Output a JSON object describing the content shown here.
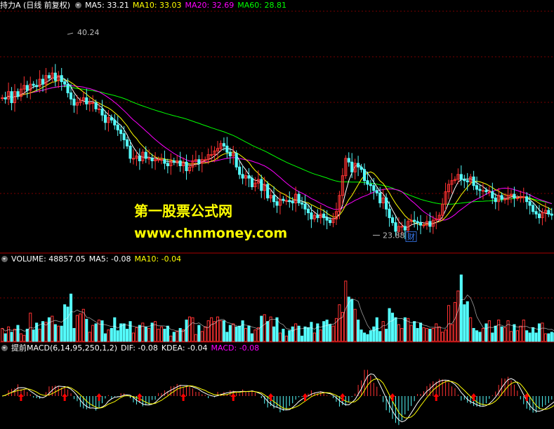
{
  "main_header": {
    "title": "持力A (日线 前复权)",
    "ma5": "MA5: 33.21",
    "ma10": "MA10: 33.03",
    "ma20": "MA20: 32.69",
    "ma60": "MA60: 28.81"
  },
  "volume_header": {
    "label": "VOLUME: 48857.05",
    "ma5": "MA5: -0.08",
    "ma10": "MA10: -0.04"
  },
  "macd_header": {
    "label": "提前MACD(6,14,95,250,1,2)",
    "dif": "DIF: -0.08",
    "kdea": "KDEA: -0.04",
    "macd": "MACD: -0.08"
  },
  "annotations": {
    "high": "40.24",
    "low": "23.88",
    "cai": "财"
  },
  "watermark": {
    "line1": "第一股票公式网",
    "line2": "www.chnmoney.com"
  },
  "colors": {
    "up": "#ff3232",
    "down": "#54fcfc",
    "ma5": "#ffffff",
    "ma10": "#ffff00",
    "ma20": "#ff00ff",
    "ma60": "#00ff00",
    "grid": "#7a0000",
    "border": "#aa0000"
  },
  "chart_data": {
    "type": "candlestick",
    "price_range": [
      22.5,
      42.0
    ],
    "price_closes": [
      35.0,
      34.9,
      35.5,
      34.6,
      35.5,
      35.1,
      35.7,
      36.0,
      35.6,
      36.1,
      36.0,
      35.9,
      36.5,
      36.1,
      36.8,
      36.6,
      37.0,
      36.4,
      36.8,
      36.3,
      36.1,
      35.4,
      34.9,
      34.4,
      34.6,
      34.8,
      35.0,
      34.5,
      34.6,
      34.6,
      34.1,
      34.1,
      33.6,
      33.0,
      33.4,
      33.2,
      32.8,
      32.4,
      32.1,
      31.6,
      31.1,
      30.1,
      30.1,
      30.3,
      29.9,
      30.6,
      30.1,
      30.1,
      29.9,
      30.0,
      30.0,
      30.0,
      29.7,
      29.5,
      29.9,
      29.8,
      29.9,
      29.5,
      29.8,
      29.1,
      29.4,
      29.9,
      30.0,
      29.7,
      30.0,
      30.0,
      30.4,
      30.4,
      30.7,
      30.9,
      31.3,
      31.1,
      30.6,
      30.3,
      30.5,
      29.4,
      28.8,
      28.5,
      28.7,
      28.5,
      27.8,
      28.1,
      28.4,
      27.5,
      28.0,
      26.9,
      27.1,
      26.6,
      26.3,
      26.8,
      26.7,
      26.7,
      26.6,
      26.5,
      27.2,
      26.5,
      26.4,
      26.0,
      25.7,
      25.2,
      25.5,
      25.3,
      25.6,
      25.3,
      25.1,
      24.9,
      25.2,
      25.8,
      27.1,
      28.7,
      30.1,
      29.8,
      29.0,
      29.7,
      29.4,
      29.2,
      28.3,
      28.0,
      27.9,
      27.5,
      27.3,
      26.5,
      26.9,
      26.0,
      25.3,
      24.9,
      24.2,
      24.6,
      24.6,
      24.3,
      25.0,
      25.1,
      25.0,
      24.9,
      24.7,
      24.7,
      25.0,
      24.6,
      25.1,
      25.2,
      25.5,
      26.4,
      27.4,
      28.0,
      28.3,
      28.4,
      28.8,
      28.4,
      28.3,
      28.2,
      28.6,
      27.9,
      27.6,
      27.5,
      27.5,
      27.4,
      27.4,
      26.9,
      26.6,
      27.1,
      26.8,
      26.8,
      27.1,
      27.2,
      26.9,
      26.9,
      27.0,
      27.0,
      26.6,
      26.3,
      25.8,
      25.6,
      25.3,
      25.7,
      25.9,
      25.6,
      25.5
    ],
    "volume_range": [
      0,
      100
    ],
    "volume_values": [
      17,
      10,
      19,
      12,
      16,
      21,
      10,
      8,
      16,
      37,
      15,
      24,
      16,
      26,
      25,
      31,
      33,
      22,
      20,
      20,
      48,
      45,
      62,
      17,
      34,
      36,
      42,
      29,
      12,
      21,
      23,
      28,
      27,
      10,
      15,
      17,
      31,
      14,
      23,
      23,
      16,
      26,
      11,
      18,
      21,
      24,
      19,
      17,
      24,
      26,
      16,
      19,
      16,
      20,
      7,
      12,
      13,
      17,
      15,
      28,
      32,
      31,
      9,
      21,
      13,
      19,
      27,
      31,
      26,
      32,
      27,
      27,
      12,
      21,
      23,
      19,
      20,
      27,
      17,
      20,
      10,
      15,
      18,
      33,
      35,
      26,
      32,
      19,
      31,
      11,
      16,
      7,
      14,
      19,
      23,
      20,
      7,
      19,
      18,
      25,
      11,
      23,
      15,
      26,
      28,
      22,
      20,
      30,
      48,
      38,
      79,
      58,
      55,
      42,
      28,
      15,
      11,
      9,
      14,
      19,
      31,
      13,
      26,
      16,
      43,
      37,
      31,
      22,
      17,
      31,
      30,
      21,
      26,
      17,
      24,
      18,
      17,
      16,
      17,
      23,
      19,
      12,
      15,
      47,
      22,
      51,
      66,
      87,
      48,
      52,
      31,
      17,
      14,
      12,
      17,
      23,
      27,
      11,
      20,
      28,
      19,
      18,
      27,
      13,
      22,
      14,
      20,
      28,
      14,
      11,
      18,
      11,
      23,
      24,
      10,
      10,
      12,
      11,
      23,
      17,
      13
    ],
    "macd_range": [
      -1.0,
      1.0
    ],
    "macd_values": [
      0.0,
      0.05,
      0.19,
      0.24,
      0.26,
      0.39,
      0.23,
      0.23,
      0.14,
      0.06,
      -0.05,
      -0.07,
      -0.09,
      0.0,
      0.13,
      0.32,
      0.33,
      0.35,
      0.31,
      0.28,
      0.32,
      0.22,
      0.09,
      -0.1,
      -0.17,
      -0.36,
      -0.41,
      -0.44,
      -0.38,
      -0.34,
      -0.48,
      -0.39,
      -0.24,
      -0.08,
      0.03,
      -0.09,
      -0.03,
      -0.01,
      0.09,
      0.09,
      0.0,
      -0.07,
      -0.21,
      -0.28,
      -0.23,
      -0.34,
      -0.31,
      -0.3,
      -0.13,
      -0.12,
      0.1,
      0.1,
      0.19,
      0.16,
      0.32,
      0.33,
      0.4,
      0.37,
      0.3,
      0.33,
      0.34,
      0.25,
      0.14,
      0.14,
      0.06,
      0.04,
      -0.07,
      0.02,
      -0.04,
      0.14,
      0.08,
      0.14,
      0.07,
      0.19,
      0.18,
      0.13,
      0.09,
      0.22,
      0.16,
      0.12,
      0.19,
      0.12,
      0.0,
      -0.07,
      -0.25,
      -0.38,
      -0.33,
      -0.41,
      -0.37,
      -0.54,
      -0.49,
      -0.45,
      -0.33,
      -0.24,
      -0.12,
      -0.04,
      -0.03,
      0.01,
      0.08,
      0.19,
      0.12,
      0.09,
      0.16,
      0.12,
      0.03,
      0.01,
      -0.07,
      -0.19,
      -0.35,
      -0.3,
      -0.32,
      -0.19,
      -0.03,
      0.08,
      0.37,
      0.52,
      0.87,
      0.87,
      0.68,
      0.44,
      0.31,
      0.04,
      -0.2,
      -0.47,
      -0.55,
      -0.76,
      -0.89,
      -0.96,
      -0.81,
      -0.61,
      -0.49,
      -0.33,
      -0.17,
      0.07,
      0.07,
      0.16,
      0.33,
      0.41,
      0.49,
      0.48,
      0.57,
      0.55,
      0.51,
      0.45,
      0.32,
      0.26,
      0.05,
      -0.15,
      -0.12,
      -0.22,
      -0.26,
      -0.33,
      -0.35,
      -0.36,
      -0.32,
      -0.24,
      -0.09,
      0.03,
      0.15,
      0.37,
      0.59,
      0.58,
      0.64,
      0.52,
      0.38,
      0.18,
      -0.11,
      -0.27,
      -0.42,
      -0.47,
      -0.55,
      -0.55,
      -0.44,
      -0.36,
      -0.3,
      -0.23,
      -0.12,
      -0.05,
      -0.02,
      0.12,
      0.17,
      0.28,
      0.24,
      0.27,
      0.23,
      0.15,
      0.1,
      -0.05,
      -0.1,
      -0.16,
      -0.26,
      -0.31,
      -0.31,
      -0.29,
      -0.28,
      -0.12,
      -0.15,
      -0.07,
      -0.12,
      -0.02,
      0.03,
      -0.05
    ],
    "arrow_bar_indices": [
      6,
      20,
      31,
      44,
      58,
      74,
      86,
      97,
      109,
      125,
      139,
      151,
      168,
      184
    ]
  }
}
